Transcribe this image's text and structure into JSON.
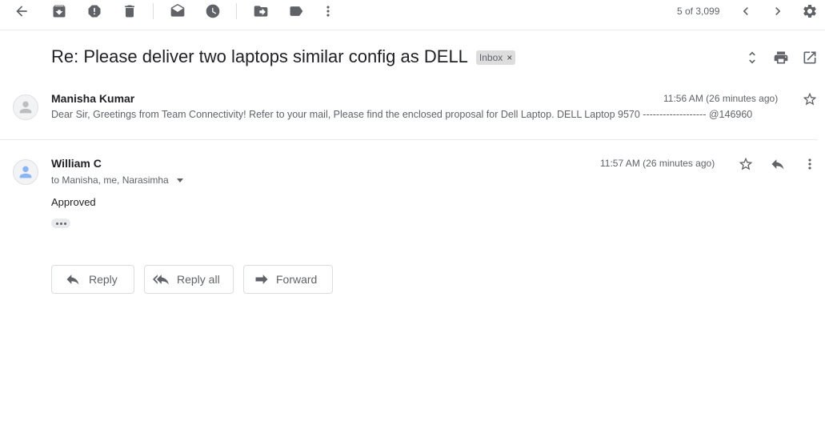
{
  "toolbar": {
    "back_icon": "arrow-back-icon",
    "archive_icon": "archive-icon",
    "spam_icon": "report-spam-icon",
    "delete_icon": "delete-icon",
    "mark_unread_icon": "mark-unread-icon",
    "snooze_icon": "snooze-icon",
    "move_icon": "move-to-icon",
    "label_icon": "label-icon",
    "more_icon": "more-vert-icon",
    "pager_text": "5 of 3,099",
    "settings_icon": "gear-icon"
  },
  "thread": {
    "subject": "Re: Please deliver two laptops similar config as DELL",
    "label": "Inbox",
    "label_remove": "×"
  },
  "messages": [
    {
      "sender": "Manisha Kumar",
      "time": "11:56 AM (26 minutes ago)",
      "snippet": "Dear Sir, Greetings from Team Connectivity! Refer to your mail, Please find the enclosed proposal for Dell Laptop. DELL Laptop 9570 ------------------- @146960"
    },
    {
      "sender": "William C",
      "time": "11:57 AM (26 minutes ago)",
      "recipients": "to Manisha, me, Narasimha",
      "body": "Approved"
    }
  ],
  "actions": {
    "reply": "Reply",
    "reply_all": "Reply all",
    "forward": "Forward"
  },
  "colors": {
    "icon": "#5f6368",
    "text": "#202124",
    "divider": "#e8eaed",
    "chip": "#dddddd"
  }
}
